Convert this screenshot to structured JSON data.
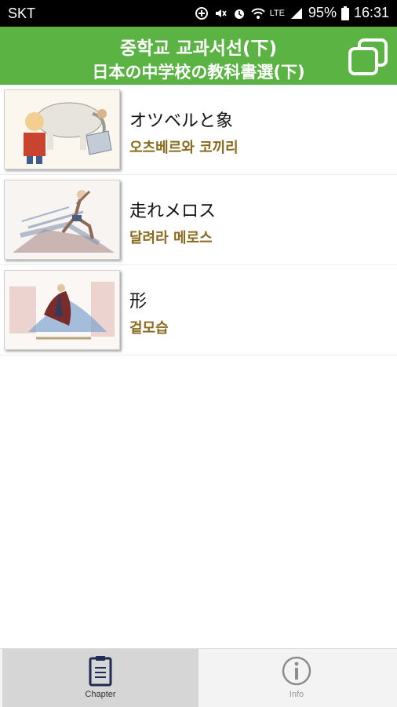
{
  "status_bar": {
    "carrier": "SKT",
    "battery": "95%",
    "time": "16:31",
    "network": "LTE",
    "icons": [
      "data-saver-icon",
      "mute-icon",
      "alarm-icon",
      "wifi-icon",
      "signal-icon",
      "battery-icon"
    ]
  },
  "header": {
    "title_ko": "중학교 교과서선(下)",
    "title_ja": "日本の中学校の教科書選(下)",
    "copy_icon": "copy-icon",
    "color": "#5bb344"
  },
  "items": [
    {
      "title": "オツベルと象",
      "subtitle": "오츠베르와 코끼리"
    },
    {
      "title": "走れメロス",
      "subtitle": "달려라 메로스"
    },
    {
      "title": "形",
      "subtitle": "겉모습"
    }
  ],
  "tabs": [
    {
      "label": "Chapter",
      "icon": "clipboard-icon",
      "active": true
    },
    {
      "label": "Info",
      "icon": "info-icon",
      "active": false
    }
  ]
}
